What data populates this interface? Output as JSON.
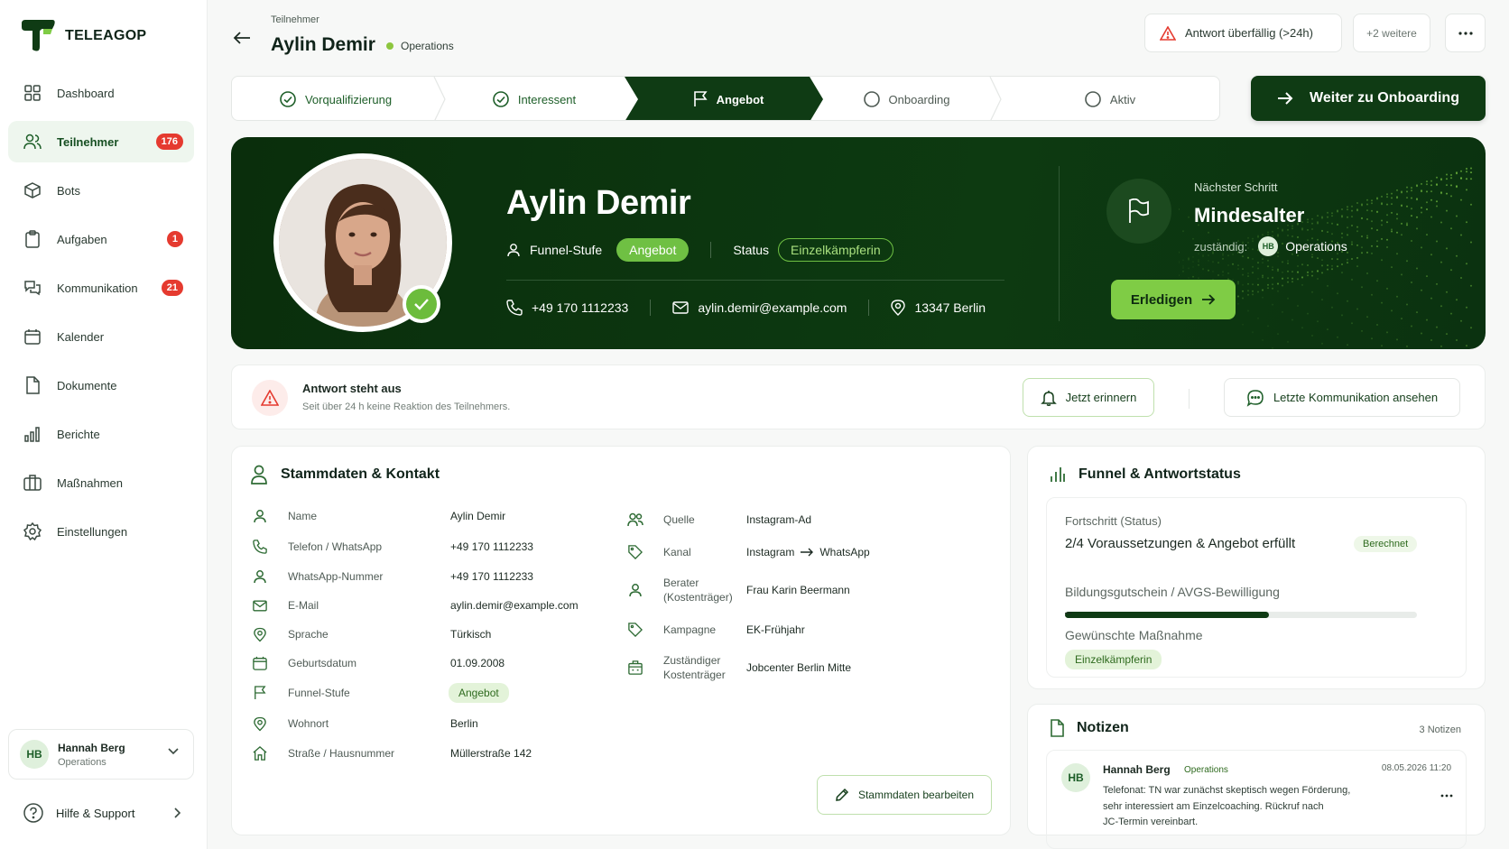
{
  "app": {
    "brand": "TELEAGOP"
  },
  "sidebar": {
    "items": [
      {
        "label": "Dashboard",
        "icon": "grid-icon"
      },
      {
        "label": "Teilnehmer",
        "icon": "users-icon",
        "badge": "176",
        "active": true
      },
      {
        "label": "Bots",
        "icon": "bot-icon"
      },
      {
        "label": "Aufgaben",
        "icon": "clipboard-icon",
        "badge": "1"
      },
      {
        "label": "Kommunikation",
        "icon": "chat-icon",
        "badge": "21"
      },
      {
        "label": "Kalender",
        "icon": "calendar-icon"
      },
      {
        "label": "Dokumente",
        "icon": "document-icon"
      },
      {
        "label": "Berichte",
        "icon": "bar-chart-icon"
      },
      {
        "label": "Maßnahmen",
        "icon": "briefcase-icon"
      },
      {
        "label": "Einstellungen",
        "icon": "gear-icon"
      }
    ],
    "user": {
      "initials": "HB",
      "name": "Hannah Berg",
      "role": "Operations"
    },
    "help": "Hilfe & Support"
  },
  "header": {
    "breadcrumb": "Teilnehmer",
    "title": "Aylin Demir",
    "department": "Operations",
    "alert_chip": "Antwort überfällig (>24h)",
    "more_chip": "+2 weitere"
  },
  "stepper": {
    "steps": [
      {
        "label": "Vorqualifizierung",
        "state": "done"
      },
      {
        "label": "Interessent",
        "state": "done"
      },
      {
        "label": "Angebot",
        "state": "active"
      },
      {
        "label": "Onboarding",
        "state": "todo"
      },
      {
        "label": "Aktiv",
        "state": "todo"
      }
    ],
    "cta": "Weiter zu Onboarding"
  },
  "hero": {
    "name": "Aylin Demir",
    "funnel_label": "Funnel-Stufe",
    "funnel_value": "Angebot",
    "status_label": "Status",
    "status_value": "Einzelkämpferin",
    "phone": "+49 170 1112233",
    "email": "aylin.demir@example.com",
    "location": "13347 Berlin",
    "next_step_label": "Nächster Schritt",
    "next_step_title": "Mindesalter",
    "responsible_label": "zuständig:",
    "responsible_initials": "HB",
    "responsible_name": "Operations",
    "done_button": "Erledigen"
  },
  "alertbar": {
    "title": "Antwort steht aus",
    "subtitle": "Seit über 24 h keine Reaktion des Teilnehmers.",
    "remind_button": "Jetzt erinnern",
    "comm_button": "Letzte Kommunikation ansehen"
  },
  "stammdaten": {
    "title": "Stammdaten & Kontakt",
    "left": [
      {
        "label": "Name",
        "value": "Aylin Demir",
        "icon": "user-icon"
      },
      {
        "label": "Telefon / WhatsApp",
        "value": "+49 170 1112233",
        "icon": "phone-icon"
      },
      {
        "label": "WhatsApp-Nummer",
        "value": "+49 170 1112233",
        "icon": "user-icon"
      },
      {
        "label": "E-Mail",
        "value": "aylin.demir@example.com",
        "icon": "mail-icon"
      },
      {
        "label": "Sprache",
        "value": "Türkisch",
        "icon": "pin-icon"
      },
      {
        "label": "Geburtsdatum",
        "value": "01.09.2008",
        "icon": "calendar-icon"
      },
      {
        "label": "Funnel-Stufe",
        "value": "Angebot",
        "icon": "flag-icon"
      },
      {
        "label": "Wohnort",
        "value": "Berlin",
        "icon": "pin-icon"
      },
      {
        "label": "Straße / Hausnummer",
        "value": "Müllerstraße 142",
        "icon": "home-icon"
      }
    ],
    "right": [
      {
        "label": "Quelle",
        "value": "Instagram-Ad",
        "icon": "users-icon"
      },
      {
        "label": "Kanal",
        "value_from": "Instagram",
        "value_to": "WhatsApp",
        "icon": "tag-icon"
      },
      {
        "label": "Berater (Kostenträger)",
        "value": "Frau Karin Beermann",
        "icon": "user-icon"
      },
      {
        "label": "Kampagne",
        "value": "EK-Frühjahr",
        "icon": "tag-icon"
      },
      {
        "label": "Zuständiger Kostenträger",
        "value": "Jobcenter Berlin Mitte",
        "icon": "building-icon"
      }
    ],
    "edit_button": "Stammdaten bearbeiten"
  },
  "funnel": {
    "title": "Funnel & Antwortstatus",
    "progress_label": "Fortschritt (Status)",
    "progress_text": "2/4 Voraussetzungen & Angebot erfüllt",
    "progress_badge": "Berechnet",
    "progress_value": 0.58,
    "bildung_label": "Bildungsgutschein / AVGS-Bewilligung",
    "bildung_value": "–",
    "massnahme_label": "Gewünschte Maßnahme",
    "massnahme_value": "Einzelkämpferin"
  },
  "notes": {
    "title": "Notizen",
    "count": "3 Notizen",
    "items": [
      {
        "initials": "HB",
        "author": "Hannah Berg",
        "role": "Operations",
        "date": "08.05.2026 11:20",
        "line1": "Telefonat: TN war zunächst skeptisch wegen Förderung,",
        "line2": "sehr interessiert am Einzelcoaching. Rückruf nach",
        "line3": "JC-Termin vereinbart."
      }
    ]
  },
  "colors": {
    "primary": "#0f3b14",
    "accent": "#7fcc45",
    "danger": "#e53a2f"
  }
}
